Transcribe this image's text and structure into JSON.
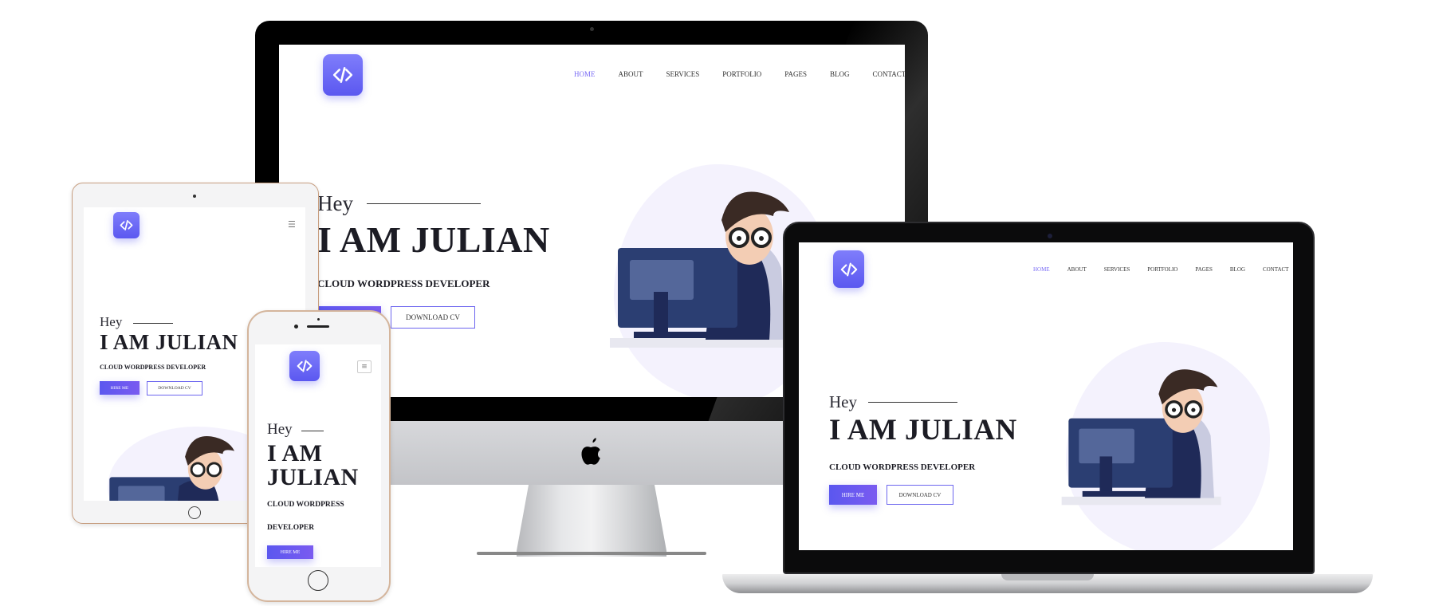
{
  "brand": {
    "logo_icon": "code-brackets-icon",
    "accent": "#6c63f2",
    "apple_logo_icon": "apple-logo-icon"
  },
  "nav": {
    "items": [
      "HOME",
      "ABOUT",
      "SERVICES",
      "PORTFOLIO",
      "PAGES",
      "BLOG",
      "CONTACT"
    ],
    "active": "HOME"
  },
  "hero": {
    "greeting": "Hey",
    "name": "I AM JULIAN",
    "name_line1": "I AM",
    "name_line2": "JULIAN",
    "role": "CLOUD WORDPRESS DEVELOPER",
    "role_line1": "CLOUD WORDPRESS",
    "role_line2": "DEVELOPER",
    "hire_label": "HIRE ME",
    "cv_label": "DOWNLOAD CV"
  },
  "menu_icon": "hamburger-menu-icon"
}
